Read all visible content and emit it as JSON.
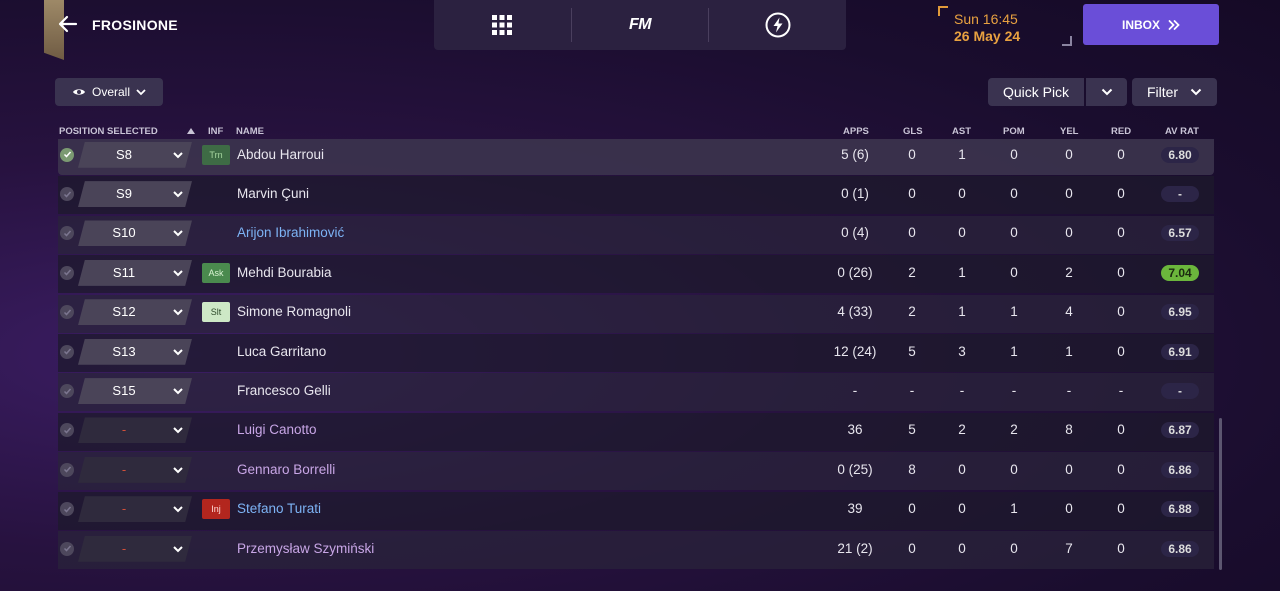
{
  "header": {
    "club": "FROSINONE",
    "time": "Sun 16:45",
    "date": "26 May 24",
    "inbox_label": "INBOX",
    "fm_label": "FM"
  },
  "toolbar": {
    "view_label": "Overall",
    "quick_pick_label": "Quick Pick",
    "filter_label": "Filter"
  },
  "columns": {
    "position_selected": "POSITION SELECTED",
    "inf": "INF",
    "name": "NAME",
    "apps": "APPS",
    "gls": "GLS",
    "ast": "AST",
    "pom": "POM",
    "yel": "YEL",
    "red": "RED",
    "av_rat": "AV RAT"
  },
  "colors": {
    "accent": "#6a4ed8",
    "date": "#e8a140",
    "rating_high": "#6bb63c",
    "injury": "#b3261e",
    "link_name": "#7db3f5",
    "loan_name": "#c8a6e6"
  },
  "rows": [
    {
      "position": "S8",
      "inf": "Trn",
      "name": "Abdou Harroui",
      "apps": "5 (6)",
      "gls": "0",
      "ast": "1",
      "pom": "0",
      "yel": "0",
      "red": "0",
      "av_rat": "6.80"
    },
    {
      "position": "S9",
      "inf": "",
      "name": "Marvin Çuni",
      "apps": "0 (1)",
      "gls": "0",
      "ast": "0",
      "pom": "0",
      "yel": "0",
      "red": "0",
      "av_rat": "-"
    },
    {
      "position": "S10",
      "inf": "",
      "name": "Arijon Ibrahimović",
      "apps": "0 (4)",
      "gls": "0",
      "ast": "0",
      "pom": "0",
      "yel": "0",
      "red": "0",
      "av_rat": "6.57"
    },
    {
      "position": "S11",
      "inf": "Ask",
      "name": "Mehdi Bourabia",
      "apps": "0 (26)",
      "gls": "2",
      "ast": "1",
      "pom": "0",
      "yel": "2",
      "red": "0",
      "av_rat": "7.04"
    },
    {
      "position": "S12",
      "inf": "Slt",
      "name": "Simone Romagnoli",
      "apps": "4 (33)",
      "gls": "2",
      "ast": "1",
      "pom": "1",
      "yel": "4",
      "red": "0",
      "av_rat": "6.95"
    },
    {
      "position": "S13",
      "inf": "",
      "name": "Luca Garritano",
      "apps": "12 (24)",
      "gls": "5",
      "ast": "3",
      "pom": "1",
      "yel": "1",
      "red": "0",
      "av_rat": "6.91"
    },
    {
      "position": "S15",
      "inf": "",
      "name": "Francesco Gelli",
      "apps": "-",
      "gls": "-",
      "ast": "-",
      "pom": "-",
      "yel": "-",
      "red": "-",
      "av_rat": "-"
    },
    {
      "position": "-",
      "inf": "",
      "name": "Luigi Canotto",
      "apps": "36",
      "gls": "5",
      "ast": "2",
      "pom": "2",
      "yel": "8",
      "red": "0",
      "av_rat": "6.87"
    },
    {
      "position": "-",
      "inf": "",
      "name": "Gennaro Borrelli",
      "apps": "0 (25)",
      "gls": "8",
      "ast": "0",
      "pom": "0",
      "yel": "0",
      "red": "0",
      "av_rat": "6.86"
    },
    {
      "position": "-",
      "inf": "Inj",
      "name": "Stefano Turati",
      "apps": "39",
      "gls": "0",
      "ast": "0",
      "pom": "1",
      "yel": "0",
      "red": "0",
      "av_rat": "6.88"
    },
    {
      "position": "-",
      "inf": "",
      "name": "Przemysław Szymiński",
      "apps": "21 (2)",
      "gls": "0",
      "ast": "0",
      "pom": "0",
      "yel": "7",
      "red": "0",
      "av_rat": "6.86"
    }
  ]
}
